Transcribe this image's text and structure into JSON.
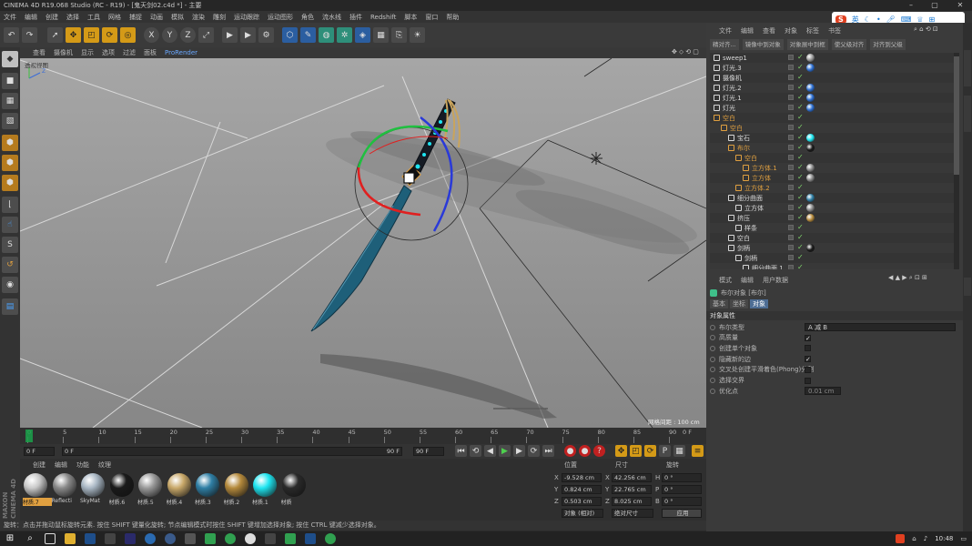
{
  "window": {
    "title": "CINEMA 4D R19.068 Studio (RC - R19) - [鬼天剑02.c4d *] - 主要"
  },
  "menu": [
    "文件",
    "编辑",
    "创建",
    "选择",
    "工具",
    "网格",
    "捕捉",
    "动画",
    "模拟",
    "渲染",
    "雕刻",
    "运动跟踪",
    "运动图形",
    "角色",
    "流水线",
    "插件",
    "Redshift",
    "脚本",
    "窗口",
    "帮助"
  ],
  "ime": {
    "label": "英"
  },
  "viewport": {
    "menu": [
      "查看",
      "摄像机",
      "显示",
      "选项",
      "过滤",
      "面板",
      "ProRender"
    ],
    "view_label": "透视视图",
    "grid_info": "网格间距 : 100 cm"
  },
  "timeline": {
    "ticks": [
      "0",
      "5",
      "10",
      "15",
      "20",
      "25",
      "30",
      "35",
      "40",
      "45",
      "50",
      "55",
      "60",
      "65",
      "70",
      "75",
      "80",
      "85",
      "90"
    ],
    "start_field": "0 F",
    "current_field": "0 F",
    "end_inner": "90 F",
    "end_field": "90 F",
    "current_marker_frame": 0,
    "end_frame_suffix": "0 F"
  },
  "material_panel": {
    "menu": [
      "创建",
      "编辑",
      "功能",
      "纹理"
    ],
    "materials": [
      {
        "name": "材质.7",
        "color": "#c9c9c9",
        "selected": true
      },
      {
        "name": "Reflecti",
        "color": "#8a8a8a"
      },
      {
        "name": "SkyMat",
        "color": "#a9b7c4"
      },
      {
        "name": "材质.6",
        "color": "#1a1a1a"
      },
      {
        "name": "材质.5",
        "color": "#9a9a9a"
      },
      {
        "name": "材质.4",
        "color": "#c9a96a"
      },
      {
        "name": "材质.3",
        "color": "#2f7fa5"
      },
      {
        "name": "材质.2",
        "color": "#b58a3c"
      },
      {
        "name": "材质.1",
        "color": "#1ee5f0"
      },
      {
        "name": "材质",
        "color": "#2a2a2a"
      }
    ]
  },
  "coords": {
    "headers": [
      "位置",
      "尺寸",
      "旋转"
    ],
    "rows": [
      {
        "axis": "X",
        "pos": "-9.528 cm",
        "size_axis": "X",
        "size": "42.256 cm",
        "rot_axis": "H",
        "rot": "0 °"
      },
      {
        "axis": "Y",
        "pos": "0.824 cm",
        "size_axis": "Y",
        "size": "22.765 cm",
        "rot_axis": "P",
        "rot": "0 °"
      },
      {
        "axis": "Z",
        "pos": "0.503 cm",
        "size_axis": "Z",
        "size": "8.025 cm",
        "rot_axis": "B",
        "rot": "0 °"
      }
    ],
    "mode1": "对象 (相对)",
    "mode2": "绝对尺寸",
    "apply": "应用"
  },
  "statusbar": {
    "text": "旋转：点击并拖动鼠标旋转元素. 按住 SHIFT 键量化旋转; 节点编辑模式时按住 SHIFT 键增加选择对象; 按住 CTRL 键减少选择对象。"
  },
  "object_manager": {
    "tabs": [
      "文件",
      "编辑",
      "查看",
      "对象",
      "标签",
      "书签"
    ],
    "buttons": [
      "精对齐...",
      "镜像中到对象",
      "对象展中到框",
      "使父级对齐",
      "对齐到父级"
    ],
    "rows": [
      {
        "name": "sweep1",
        "indent": 0,
        "color": "#d8d8d8",
        "tags": [
          "#9a9a9a"
        ]
      },
      {
        "name": "灯光.3",
        "indent": 0,
        "color": "#d8d8d8",
        "tags": [
          "#2d6fd1"
        ]
      },
      {
        "name": "摄像机",
        "indent": 0,
        "color": "#d8d8d8",
        "tags": []
      },
      {
        "name": "灯光.2",
        "indent": 0,
        "color": "#d8d8d8",
        "tags": [
          "#2d6fd1"
        ]
      },
      {
        "name": "灯光.1",
        "indent": 0,
        "color": "#d8d8d8",
        "tags": [
          "#2d6fd1"
        ]
      },
      {
        "name": "灯光",
        "indent": 0,
        "color": "#d8d8d8",
        "tags": [
          "#2d6fd1"
        ]
      },
      {
        "name": "空白",
        "indent": 0,
        "color": "#e0a040",
        "tags": []
      },
      {
        "name": "空白",
        "indent": 1,
        "color": "#e0a040",
        "tags": []
      },
      {
        "name": "宝石",
        "indent": 2,
        "color": "#d8d8d8",
        "tags": [
          "#1ee5f0"
        ]
      },
      {
        "name": "布尔",
        "indent": 2,
        "color": "#e0a040",
        "tags": [
          "#1a1a1a"
        ]
      },
      {
        "name": "空白",
        "indent": 3,
        "color": "#e0a040",
        "tags": []
      },
      {
        "name": "立方体.1",
        "indent": 4,
        "color": "#e0a040",
        "tags": [
          "#888888"
        ]
      },
      {
        "name": "立方体",
        "indent": 4,
        "color": "#e0a040",
        "tags": [
          "#888888"
        ]
      },
      {
        "name": "立方体.2",
        "indent": 3,
        "color": "#e0a040",
        "tags": []
      },
      {
        "name": "细分曲面",
        "indent": 2,
        "color": "#d8d8d8",
        "tags": [
          "#2f7fa5"
        ]
      },
      {
        "name": "立方体",
        "indent": 3,
        "color": "#d8d8d8",
        "tags": [
          "#888888"
        ]
      },
      {
        "name": "挤压",
        "indent": 2,
        "color": "#d8d8d8",
        "tags": [
          "#b58a3c"
        ]
      },
      {
        "name": "样条",
        "indent": 3,
        "color": "#d8d8d8",
        "tags": []
      },
      {
        "name": "空白",
        "indent": 2,
        "color": "#d8d8d8",
        "tags": []
      },
      {
        "name": "剑柄",
        "indent": 2,
        "color": "#d8d8d8",
        "tags": [
          "#1a1a1a"
        ]
      },
      {
        "name": "剑柄",
        "indent": 3,
        "color": "#d8d8d8",
        "tags": []
      },
      {
        "name": "细分曲面.1",
        "indent": 4,
        "color": "#d8d8d8",
        "tags": []
      }
    ]
  },
  "attributes": {
    "tabs": [
      "模式",
      "编辑",
      "用户数据"
    ],
    "object_title": "布尔对象 [布尔]",
    "subtabs": [
      "基本",
      "坐标",
      "对象"
    ],
    "section": "对象属性",
    "fields": [
      {
        "label": "布尔类型",
        "type": "select",
        "value": "A 减 B"
      },
      {
        "label": "高质量",
        "type": "check",
        "value": "✓"
      },
      {
        "label": "创建单个对象",
        "type": "check",
        "value": ""
      },
      {
        "label": "隐藏新的边",
        "type": "check",
        "value": "✓"
      },
      {
        "label": "交叉处创建平滑着色(Phong)分割",
        "type": "check",
        "value": ""
      },
      {
        "label": "选择交界",
        "type": "check",
        "value": ""
      },
      {
        "label": "优化点",
        "type": "input",
        "value": "0.01 cm"
      }
    ]
  },
  "taskbar": {
    "time": "10:48"
  },
  "brand": {
    "line1": "MAXON",
    "line2": "CINEMA 4D"
  },
  "colors": {
    "accent": "#e0a040",
    "cyan": "#1ee5f0",
    "background": "#2b2b2b"
  }
}
